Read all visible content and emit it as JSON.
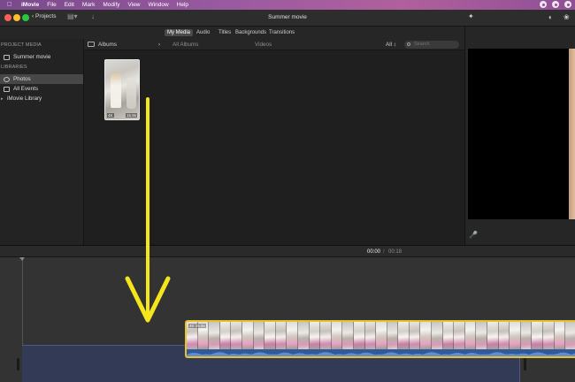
{
  "menubar": {
    "app_name": "iMovie",
    "items": [
      "File",
      "Edit",
      "Mark",
      "Modify",
      "View",
      "Window",
      "Help"
    ]
  },
  "titlebar": {
    "back_label": "Projects",
    "window_title": "Summer movie"
  },
  "tabs": [
    "My Media",
    "Audio",
    "Titles",
    "Backgrounds",
    "Transitions"
  ],
  "sidebar": {
    "project_media_header": "PROJECT MEDIA",
    "project_item": "Summer movie",
    "libraries_header": "LIBRARIES",
    "library_items": [
      "Photos",
      "All Events",
      "iMovie Library"
    ]
  },
  "browser": {
    "album_select": "Albums",
    "album_filter": "All Albums",
    "kind_filter": "Videos",
    "show_filter": "All",
    "search_placeholder": "Search",
    "clip_badges": [
      "4K",
      "15.9s"
    ]
  },
  "timeline": {
    "current_time": "00:00",
    "separator": "/",
    "duration": "00:18",
    "clip_badge": "4K 15.9s"
  },
  "colors": {
    "selection_yellow": "#e6c231",
    "arrow_yellow": "#f5e51b",
    "audio_blue": "#2f5a9c"
  }
}
